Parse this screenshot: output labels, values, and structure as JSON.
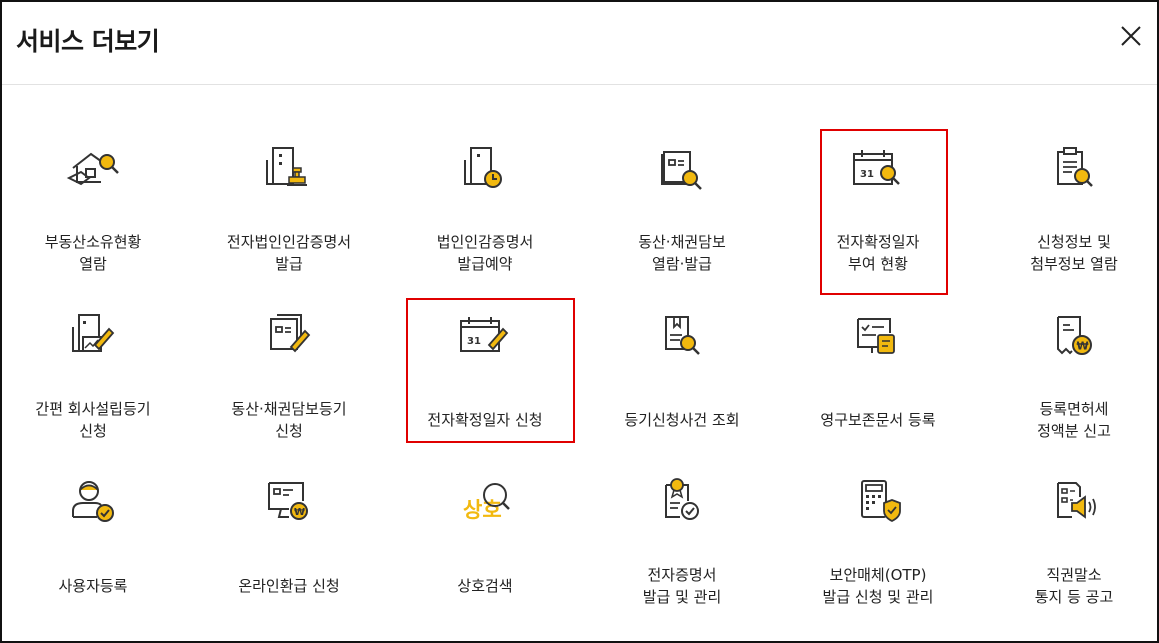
{
  "dialog": {
    "title": "서비스 더보기",
    "close_label": "close"
  },
  "colors": {
    "accent": "#f2b90f",
    "line": "#333333",
    "highlight": "#e00000"
  },
  "items": [
    {
      "label": "부동산소유현황\n열람",
      "icon": "house-search-icon"
    },
    {
      "label": "전자법인인감증명서\n발급",
      "icon": "building-stamp-icon"
    },
    {
      "label": "법인인감증명서\n발급예약",
      "icon": "building-clock-icon"
    },
    {
      "label": "동산·채권담보\n열람·발급",
      "icon": "document-search-icon"
    },
    {
      "label": "전자확정일자\n부여 현황",
      "icon": "calendar-search-icon"
    },
    {
      "label": "신청정보 및\n첨부정보 열람",
      "icon": "clipboard-search-icon"
    },
    {
      "label": "간편 회사설립등기\n신청",
      "icon": "building-chart-pen-icon"
    },
    {
      "label": "동산·채권담보등기\n신청",
      "icon": "document-pen-icon"
    },
    {
      "label": "전자확정일자 신청",
      "icon": "calendar-pen-icon"
    },
    {
      "label": "등기신청사건 조회",
      "icon": "book-search-icon"
    },
    {
      "label": "영구보존문서 등록",
      "icon": "document-scroll-icon"
    },
    {
      "label": "등록면허세\n정액분 신고",
      "icon": "receipt-won-icon"
    },
    {
      "label": "사용자등록",
      "icon": "user-check-icon"
    },
    {
      "label": "온라인환급 신청",
      "icon": "monitor-won-icon"
    },
    {
      "label": "상호검색",
      "icon": "trade-name-search-icon",
      "icon_text": "상호"
    },
    {
      "label": "전자증명서\n발급 및 관리",
      "icon": "certificate-check-icon"
    },
    {
      "label": "보안매체(OTP)\n발급 신청 및 관리",
      "icon": "otp-shield-icon"
    },
    {
      "label": "직권말소\n통지 등 공고",
      "icon": "document-megaphone-icon"
    }
  ],
  "calendar_number": "31"
}
